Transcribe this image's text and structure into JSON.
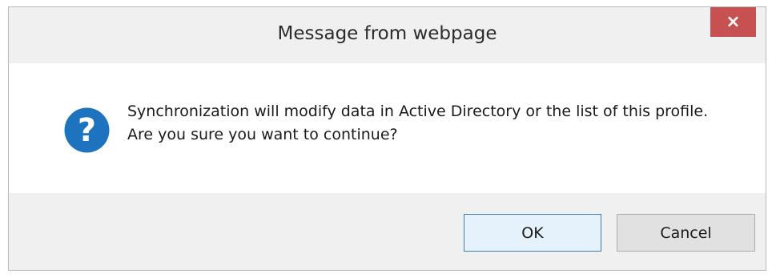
{
  "dialog": {
    "title": "Message from webpage",
    "close_label": "×",
    "message": "Synchronization will modify data in Active Directory or the list of this profile. Are you sure you want to continue?",
    "icon": "question-icon",
    "buttons": {
      "ok_label": "OK",
      "cancel_label": "Cancel"
    }
  },
  "colors": {
    "close_button": "#c75050",
    "question_icon": "#1e73be",
    "ok_border": "#3c7fb1"
  }
}
